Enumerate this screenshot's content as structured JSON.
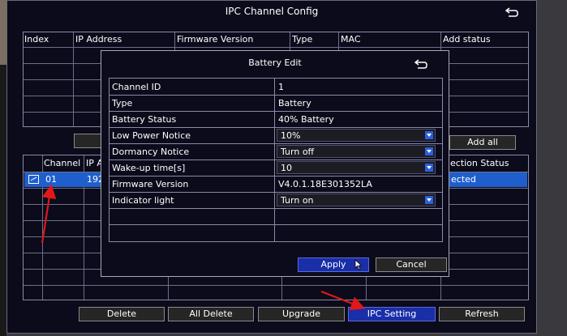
{
  "window": {
    "title": "IPC Channel Config"
  },
  "top_table": {
    "headers": [
      "Index",
      "IP Address",
      "Firmware Version",
      "Type",
      "MAC",
      "Add status"
    ]
  },
  "top_buttons": {
    "add_all": "Add all"
  },
  "bottom_table": {
    "headers": [
      "Channel",
      "IP A",
      "ection Status"
    ],
    "rows": [
      {
        "channel": "01",
        "ip": "192",
        "status": "ected"
      }
    ]
  },
  "footer_buttons": {
    "delete": "Delete",
    "all_delete": "All Delete",
    "upgrade": "Upgrade",
    "ipc_setting": "IPC Setting",
    "refresh": "Refresh"
  },
  "dialog": {
    "title": "Battery Edit",
    "rows": {
      "channel_id": {
        "label": "Channel ID",
        "value": "1"
      },
      "type": {
        "label": "Type",
        "value": "Battery"
      },
      "battery_status": {
        "label": "Battery Status",
        "value": "40% Battery"
      },
      "low_power_notice": {
        "label": "Low Power Notice",
        "value": "10%"
      },
      "dormancy_notice": {
        "label": "Dormancy Notice",
        "value": "Turn off"
      },
      "wakeup_time": {
        "label": "Wake-up time[s]",
        "value": "10"
      },
      "firmware_version": {
        "label": "Firmware Version",
        "value": "V4.0.1.18E301352LA"
      },
      "indicator_light": {
        "label": "Indicator light",
        "value": "Turn on"
      }
    },
    "apply": "Apply",
    "cancel": "Cancel"
  },
  "colors": {
    "selection": "#1f5fcd",
    "button_blue": "#1a2ea8",
    "annotation_arrow": "#e01818"
  },
  "icons": [
    "back-arrow-icon",
    "checkbox-icon",
    "dropdown-arrow-icon",
    "red-annotation-arrow",
    "mouse-cursor-icon"
  ]
}
